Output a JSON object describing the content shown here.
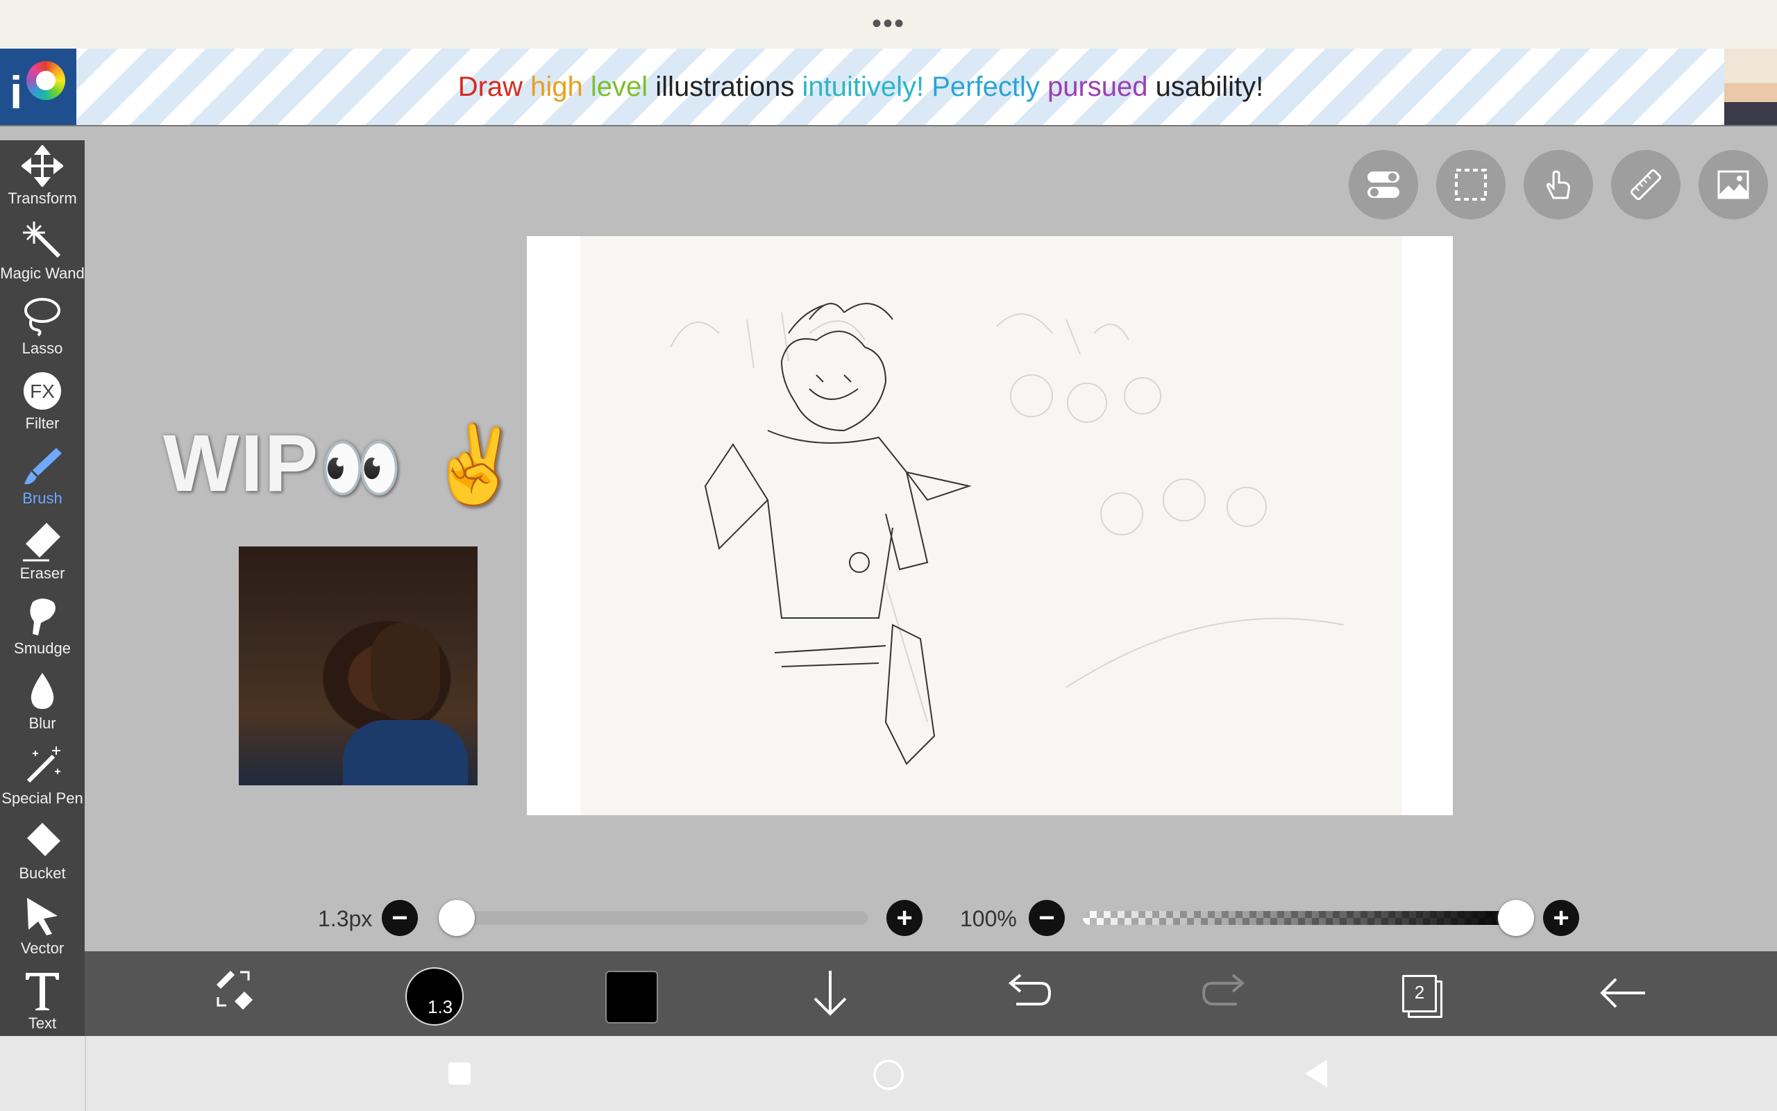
{
  "status_bar": {
    "menu_dots": "•••"
  },
  "ad_banner": {
    "logo_letter": "i",
    "words": [
      {
        "text": "Draw",
        "color": "#d72b1f"
      },
      {
        "text": "high",
        "color": "#e6a01e"
      },
      {
        "text": "level",
        "color": "#7cbf2e"
      },
      {
        "text": "illustrations",
        "color": "#222222"
      },
      {
        "text": "intuitively!",
        "color": "#2bb5c9"
      },
      {
        "text": "Perfectly",
        "color": "#2aa3d8"
      },
      {
        "text": "pursued",
        "color": "#9b3fb5"
      },
      {
        "text": "usability!",
        "color": "#222222"
      }
    ]
  },
  "tools": [
    {
      "label": "Transform",
      "icon": "move-arrows-icon"
    },
    {
      "label": "Magic Wand",
      "icon": "magic-wand-icon"
    },
    {
      "label": "Lasso",
      "icon": "lasso-icon"
    },
    {
      "label": "Filter",
      "icon": "fx-icon"
    },
    {
      "label": "Brush",
      "icon": "brush-icon",
      "active": true
    },
    {
      "label": "Eraser",
      "icon": "eraser-icon"
    },
    {
      "label": "Smudge",
      "icon": "smudge-icon"
    },
    {
      "label": "Blur",
      "icon": "blur-drop-icon"
    },
    {
      "label": "Special Pen",
      "icon": "special-pen-icon"
    },
    {
      "label": "Bucket",
      "icon": "bucket-icon"
    },
    {
      "label": "Vector",
      "icon": "vector-arrow-icon"
    },
    {
      "label": "Text",
      "icon": "text-t-icon"
    }
  ],
  "overlay": {
    "wip_text": "WIP",
    "eyes": "👀",
    "peace": "✌️"
  },
  "brush_slider": {
    "value_label": "1.3px",
    "level": 0.0
  },
  "opacity_slider": {
    "value_label": "100%",
    "level": 1.0
  },
  "bottom_toolbar": {
    "brush_size_label": "1.3",
    "color": "#000000",
    "layer_count": "2"
  },
  "accent_color": "#6ea8ff"
}
